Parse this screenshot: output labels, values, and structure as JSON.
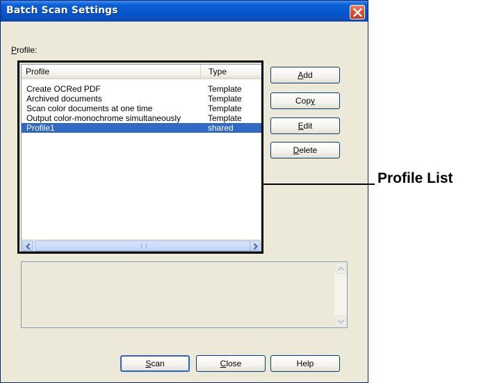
{
  "window": {
    "title": "Batch Scan Settings"
  },
  "profile_label": {
    "accel": "P",
    "rest": "rofile:"
  },
  "list": {
    "columns": [
      "Profile",
      "Type"
    ],
    "rows": [
      {
        "name": "Create OCRed PDF",
        "type": "Template"
      },
      {
        "name": "Archived documents",
        "type": "Template"
      },
      {
        "name": "Scan color documents at one time",
        "type": "Template"
      },
      {
        "name": "Output color-monochrome simultaneously",
        "type": "Template"
      },
      {
        "name": "Profile1",
        "type": "shared",
        "selected": true
      }
    ]
  },
  "buttons": {
    "add": {
      "accel": "A",
      "rest": "dd"
    },
    "copy": {
      "pre": "Cop",
      "accel": "y"
    },
    "edit": {
      "accel": "E",
      "rest": "dit"
    },
    "delete": {
      "accel": "D",
      "rest": "elete"
    },
    "scan": {
      "accel": "S",
      "rest": "can"
    },
    "close": {
      "accel": "C",
      "rest": "lose"
    },
    "help": {
      "label": "Help"
    }
  },
  "annotation": {
    "label": "Profile List"
  },
  "colors": {
    "selection": "#316ac5",
    "titlebar": "#0556cc",
    "dialog_bg": "#ece9d8"
  }
}
